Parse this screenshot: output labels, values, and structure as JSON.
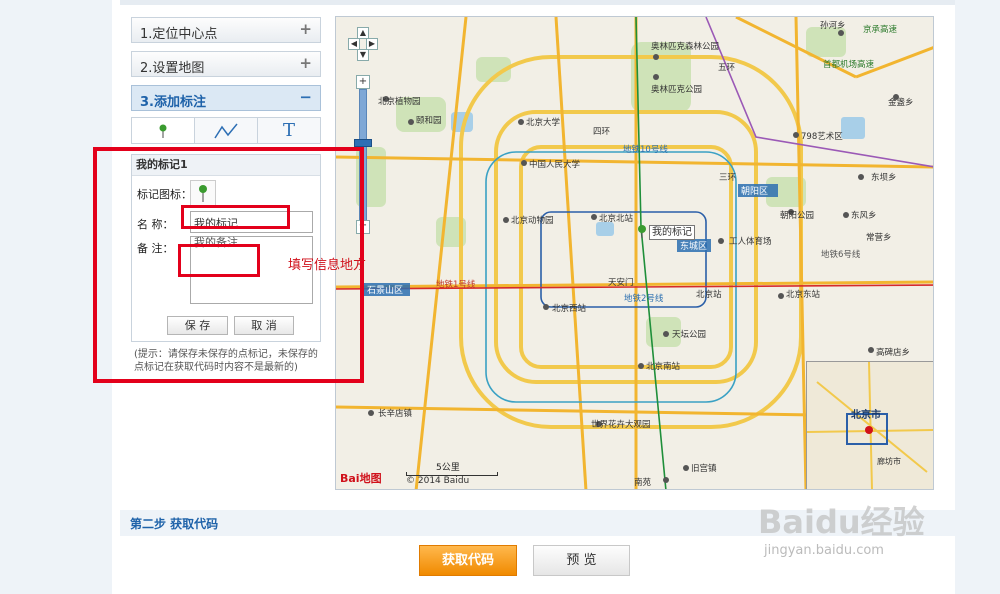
{
  "sections": [
    {
      "label": "1.定位中心点",
      "toggle": "+"
    },
    {
      "label": "2.设置地图",
      "toggle": "+"
    },
    {
      "label": "3.添加标注",
      "toggle": "−"
    }
  ],
  "tools": [
    "marker-tool",
    "line-tool",
    "text-tool"
  ],
  "tool_text_glyph": "T",
  "marker_panel": {
    "title": "我的标记1",
    "icon_label": "标记图标：",
    "name_label": "名 称：",
    "name_value": "我的标记",
    "note_label": "备 注：",
    "note_value": "我的备注",
    "save_label": "保 存",
    "cancel_label": "取 消"
  },
  "tip": "(提示：请保存未保存的点标记，未保存的点标记在获取代码时内容不是最新的)",
  "annotation": "填写信息地方",
  "map": {
    "marker_label": "我的标记",
    "copyright": "© 2014 Baidu",
    "scale_label": "5公里",
    "logo_text": "Bai地图",
    "overview_city": "北京市",
    "places": [
      {
        "name": "孙河乡"
      },
      {
        "name": "京承高速"
      },
      {
        "name": "奥林匹克森林公园"
      },
      {
        "name": "奥林匹克公园"
      },
      {
        "name": "首都机场高速"
      },
      {
        "name": "金盏乡"
      },
      {
        "name": "北京植物园"
      },
      {
        "name": "颐和园"
      },
      {
        "name": "北京大学"
      },
      {
        "name": "798艺术区"
      },
      {
        "name": "中国人民大学"
      },
      {
        "name": "朝阳区"
      },
      {
        "name": "东坝乡"
      },
      {
        "name": "北京动物园"
      },
      {
        "name": "北京北站"
      },
      {
        "name": "朝阳公园"
      },
      {
        "name": "东风乡"
      },
      {
        "name": "常营乡"
      },
      {
        "name": "工人体育场"
      },
      {
        "name": "天安门"
      },
      {
        "name": "北京站"
      },
      {
        "name": "北京东站"
      },
      {
        "name": "石景山区"
      },
      {
        "name": "北京西站"
      },
      {
        "name": "天坛公园"
      },
      {
        "name": "高碑店乡"
      },
      {
        "name": "北京南站"
      },
      {
        "name": "世界花卉大观园"
      },
      {
        "name": "长辛店镇"
      },
      {
        "name": "旧宫镇"
      },
      {
        "name": "南苑"
      },
      {
        "name": "廊坊市"
      },
      {
        "name": "东城区"
      },
      {
        "name": "五环"
      },
      {
        "name": "四环"
      },
      {
        "name": "三环"
      },
      {
        "name": "地铁10号线"
      },
      {
        "name": "地铁1号线"
      },
      {
        "name": "地铁2号线"
      },
      {
        "name": "地铁6号线"
      }
    ]
  },
  "step2": {
    "title": "第二步 获取代码",
    "get_code": "获取代码",
    "preview": "预 览"
  },
  "watermark": {
    "main": "Baidu经验",
    "sub": "jingyan.baidu.com"
  }
}
